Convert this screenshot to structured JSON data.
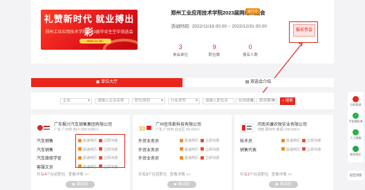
{
  "banner": {
    "headline": "礼赞新时代 就业搏出彩",
    "subtitle": "郑州工业应用技术学院2023届毕业生空中双选会",
    "dates": "2022.11.18 - 2022.12.31"
  },
  "fair": {
    "title": "郑州工业应用技术学院2023届网络双选会",
    "status_tag": "进行中",
    "time_label": "活动时间:",
    "time_value": "2022/11/18 00:00 ~ 2022/12/31 00:00",
    "stats": [
      {
        "value": "3",
        "label": "参会单位"
      },
      {
        "value": "9",
        "label": "职位数"
      },
      {
        "value": "0",
        "label": "报名人数"
      }
    ],
    "register_label": "报名参会"
  },
  "tabs": [
    {
      "label": "单位大厅",
      "active": true
    },
    {
      "label": "双选会介绍",
      "active": false
    }
  ],
  "filters": {
    "industry": "企业",
    "company_name_placeholder": "请输入企业名称",
    "position_category": "职位类别",
    "job_type": "行业类型",
    "position_name_placeholder": "请输入职位名",
    "location": "在线填报",
    "salary": "薪资要求",
    "search_label": "搜索"
  },
  "companies": [
    {
      "name": "广东枫兴汽车销售集团有限公司",
      "info": "广东 广州市 四川   500-1000人",
      "jobs": [
        "汽车销售",
        "汽车销售",
        "汽车维修学徒",
        "客服文员"
      ],
      "action1": "投递简历",
      "action2": "立即沟通",
      "more_prefix": "共有",
      "more_count": "4",
      "more_suffix": "个在招职位",
      "view_link": "查看详情 >>",
      "button_label": "面试间"
    },
    {
      "name": "广州信伟斯科技有限公司",
      "info": "广东 广州市 白云区   50-150人",
      "jobs": [
        "外贸业务员",
        "外贸业务员",
        "外贸业务员"
      ],
      "action1": "投递简历",
      "action2": "立即沟通",
      "more_prefix": "共有",
      "more_count": "3",
      "more_suffix": "个在招职位",
      "view_link": "查看详情 >>",
      "button_label": "面试间"
    },
    {
      "name": "河南天康农牧实业有限公司",
      "info": "河南 郑州市 新郑   150-500人",
      "jobs": [
        "技术员",
        "销售代表"
      ],
      "action1": "投递简历",
      "action2": "立即沟通",
      "more_prefix": "共有",
      "more_count": "2",
      "more_suffix": "个在招职位",
      "view_link": "查看详情 >>",
      "button_label": "面试间"
    }
  ],
  "side": {
    "items": [
      "扫码投递",
      "手机端投递",
      "人工客服",
      "联系我们"
    ],
    "top": "返回顶部"
  },
  "colors": {
    "accent": "#e8261d",
    "orange": "#f0880a"
  }
}
